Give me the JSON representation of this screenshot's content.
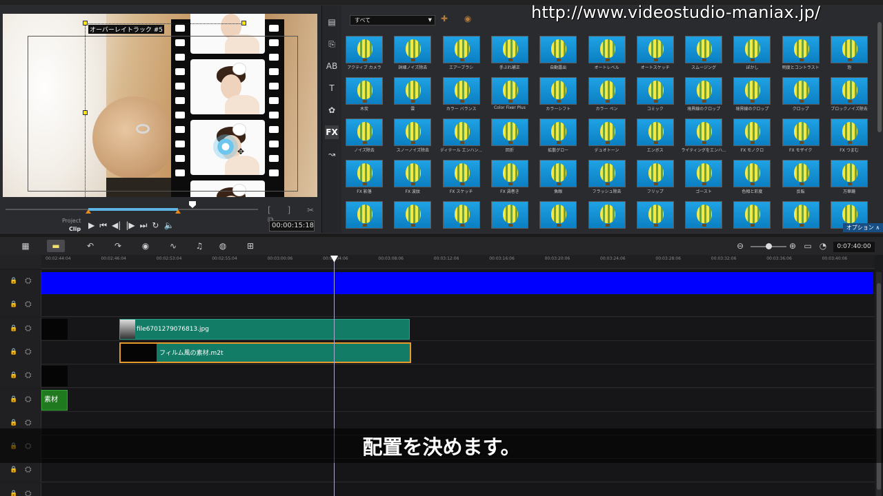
{
  "watermark": "http://www.videostudio-maniax.jp/",
  "subtitle": "配置を決めます。",
  "preview": {
    "track_label": "オーバーレイトラック #5",
    "project_label": "Project",
    "clip_label": "Clip",
    "timecode": "00:00:15:18"
  },
  "library": {
    "dropdown": "すべて",
    "options_button": "オプション ∧",
    "sidebar": [
      "media-icon",
      "instant-project-icon",
      "transition-icon",
      "title-icon",
      "graphics-icon",
      "fx-icon",
      "path-icon"
    ],
    "filters": [
      "アクティブ カメラ",
      "詳細ノイズ除去",
      "エアーブラシ",
      "手ぶれ補正",
      "自動露出",
      "オートレベル",
      "オートスケッチ",
      "スムージング",
      "ぼかし",
      "明度とコントラスト",
      "泡",
      "木炭",
      "雲",
      "カラー バランス",
      "Color Fixer Plus",
      "カラーシフト",
      "カラー ペン",
      "コミック",
      "境界線のクロップ",
      "境界線のクロップ",
      "クロップ",
      "ブロックノイズ除去",
      "ノイズ除去",
      "スノーノイズ除去",
      "ディテール エンハン...",
      "回折",
      "拡散グロー",
      "デュオトーン",
      "エンボス",
      "ライティングをエンハ...",
      "FX モノクロ",
      "FX モザイク",
      "FX つまむ",
      "FX 影落",
      "FX 波紋",
      "FX スケッチ",
      "FX 渦巻き",
      "魚眼",
      "フラッシュ除去",
      "フリップ",
      "ゴースト",
      "色相と彩度",
      "反転",
      "万華鏡",
      "",
      "",
      "",
      "",
      "",
      "",
      "",
      "",
      "",
      "",
      ""
    ]
  },
  "timeline": {
    "time": "0:07:40:00",
    "ruler": [
      "00:02:44:04",
      "00:02:46:04",
      "00:02:53:04",
      "00:02:55:04",
      "00:03:00:06",
      "00:03:04:06",
      "00:03:08:06",
      "00:03:12:06",
      "00:03:16:06",
      "00:03:20:06",
      "00:03:24:06",
      "00:03:28:06",
      "00:03:32:06",
      "00:03:36:06",
      "00:03:40:06"
    ],
    "clips": {
      "image_clip": "file6701279076813.jpg",
      "video_clip": "フィルム風の素材.m2t",
      "title_clip": "素材"
    }
  },
  "colors": {
    "accent_blue": "#0000ff",
    "clip_green": "#137c66",
    "title_green": "#1f7a1f",
    "trim_orange": "#e99a2c",
    "options_blue": "#174e84"
  }
}
